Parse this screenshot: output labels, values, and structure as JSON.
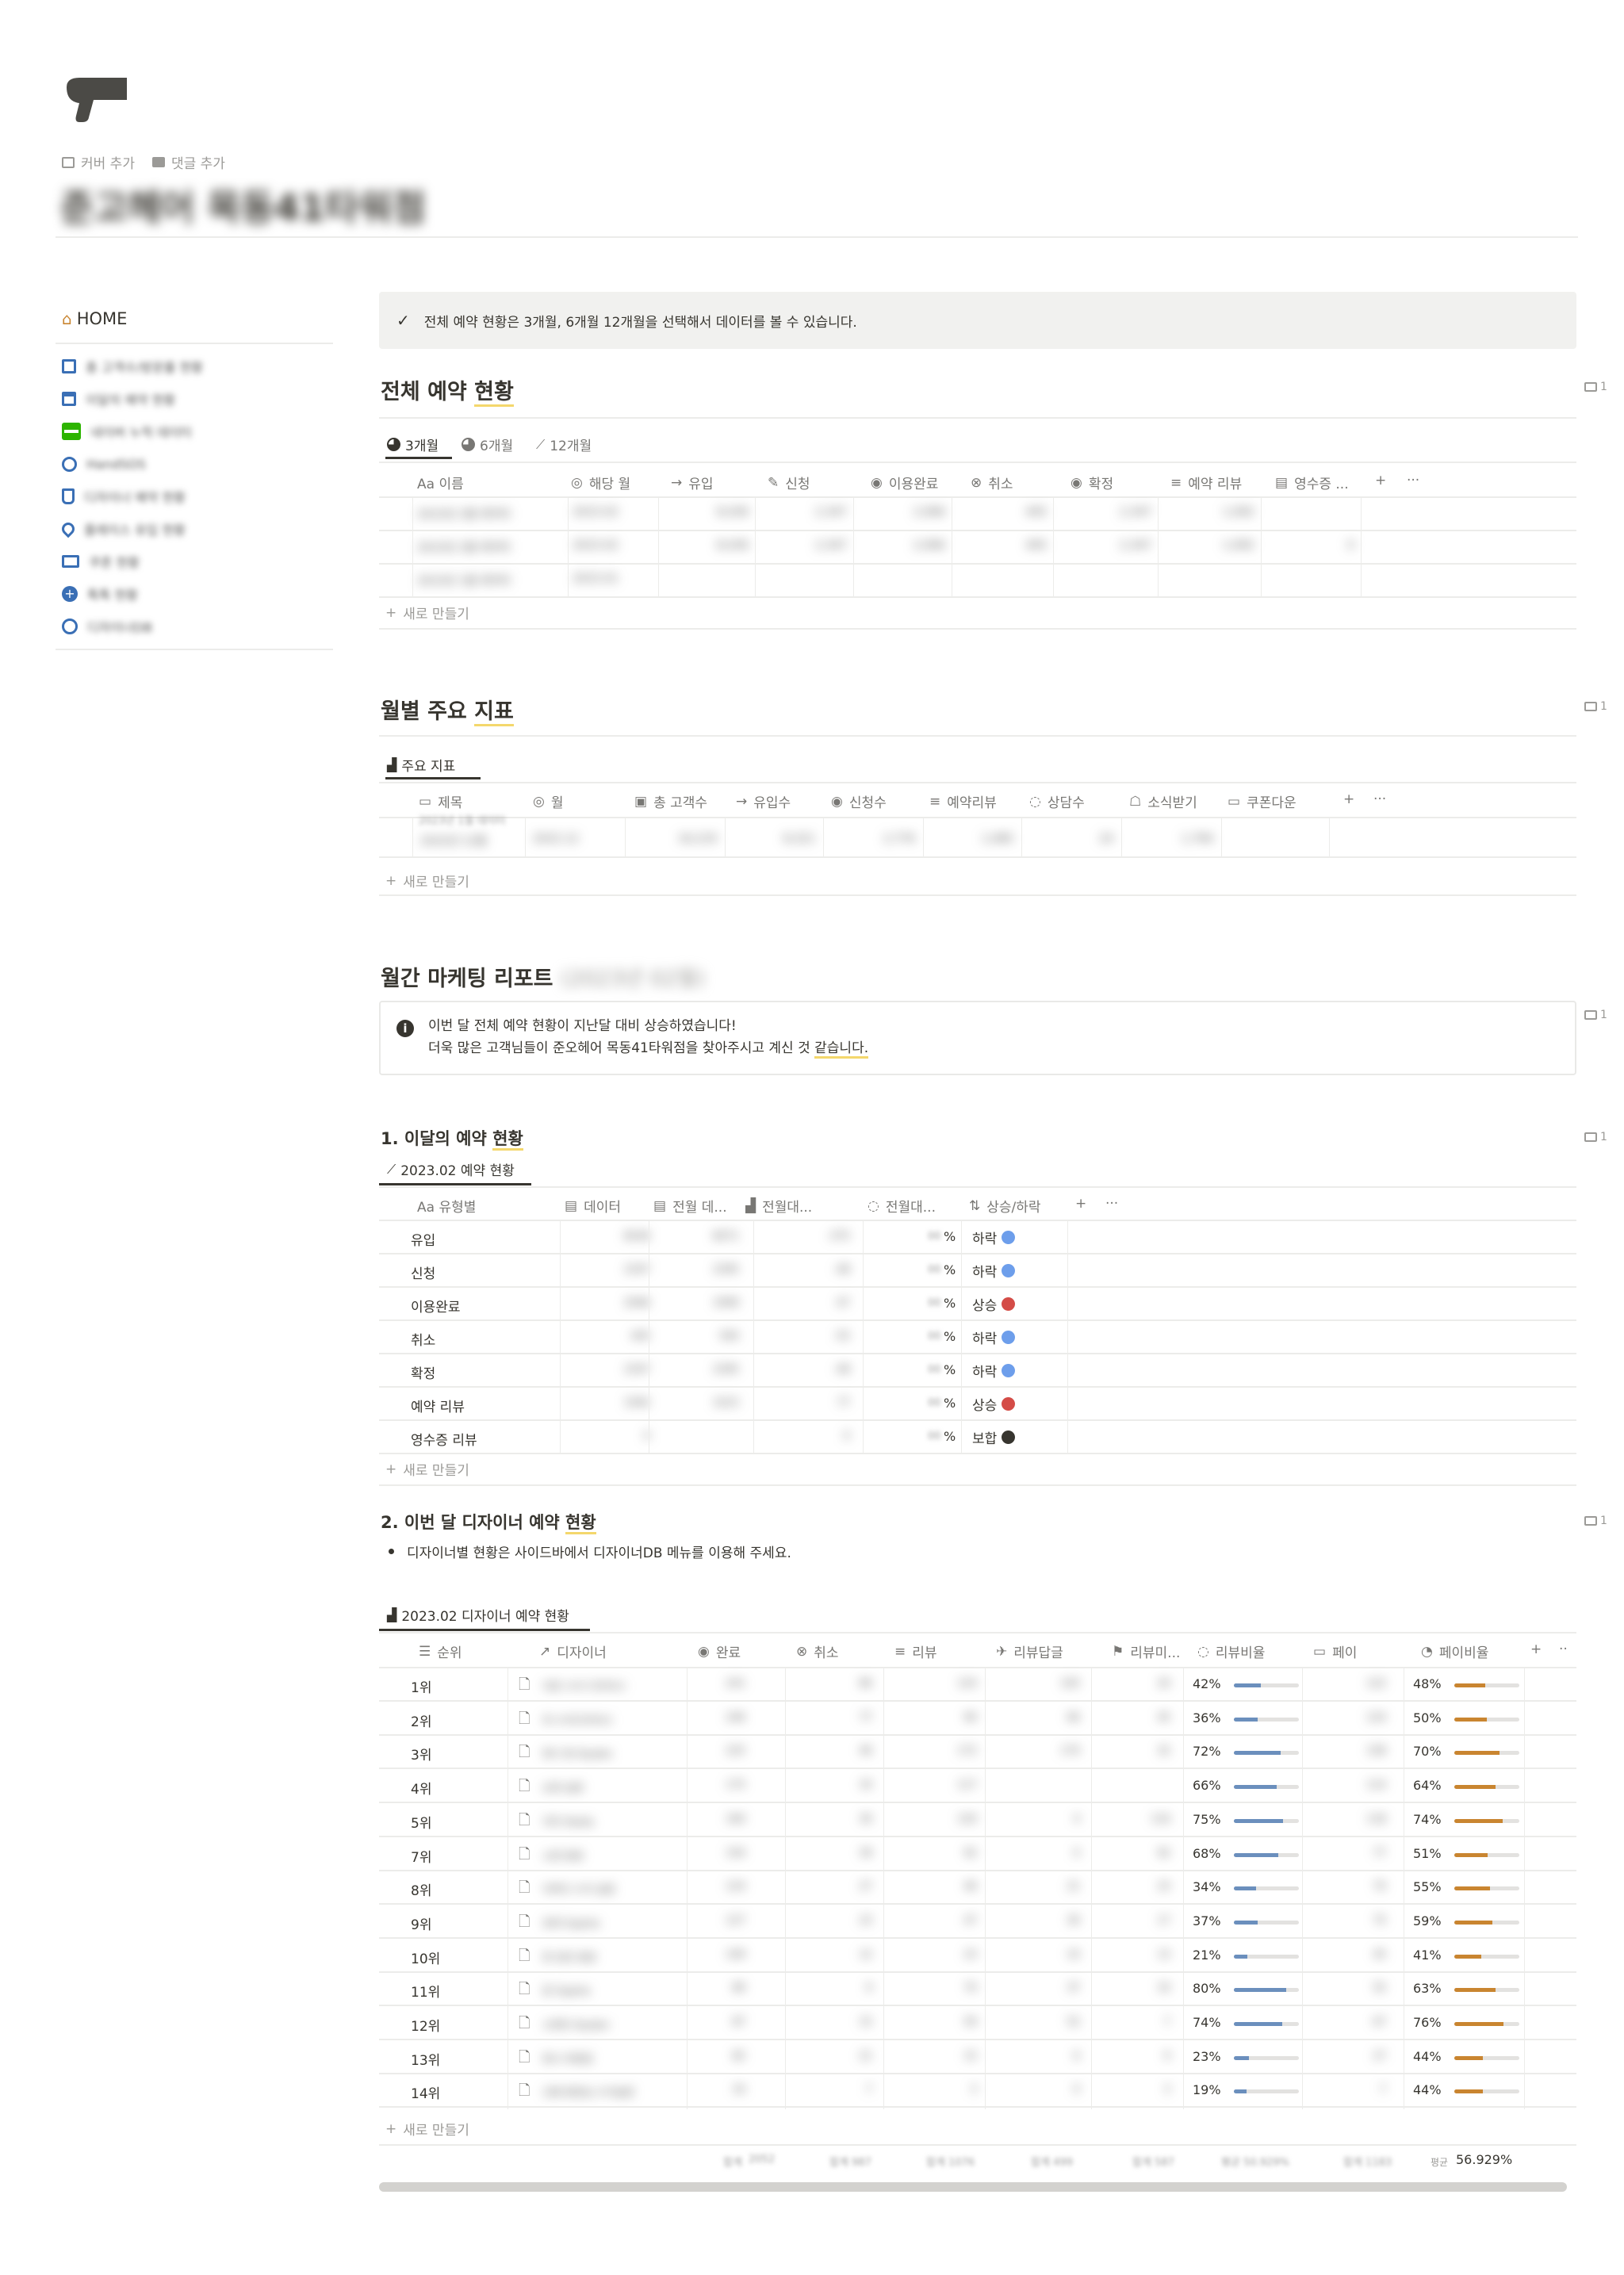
{
  "top": {
    "cover_label": "커버 추가",
    "comment_label": "댓글 추가",
    "page_title": "준고헤어 목동41타워점"
  },
  "sidebar": {
    "home": "HOME",
    "items": [
      {
        "label": "총 고객수/방문률 현황",
        "icon": "database-icon"
      },
      {
        "label": "이달의 예약 현황",
        "icon": "calendar-icon"
      },
      {
        "label": "네이버 누적 데이터",
        "icon": "naver-icon"
      },
      {
        "label": "HandSOS",
        "icon": "globe-icon"
      },
      {
        "label": "디자이너 예약 현황",
        "icon": "plug-icon"
      },
      {
        "label": "플레이스 유입 현황",
        "icon": "location-icon"
      },
      {
        "label": "쿠폰 현황",
        "icon": "ticket-icon"
      },
      {
        "label": "톡톡 현황",
        "icon": "chat-plus-icon"
      },
      {
        "label": "디자이너DB",
        "icon": "person-icon"
      }
    ]
  },
  "callout1": "전체 예약 현황은 3개월, 6개월 12개월을 선택해서 데이터를 볼 수 있습니다.",
  "section1": {
    "title_a": "전체 예약 ",
    "title_b": "현황",
    "comment_count": "1",
    "tabs": [
      "3개월",
      "6개월",
      "12개월"
    ],
    "headers": [
      "Aa 이름",
      "해당 월",
      "유입",
      "신청",
      "이용완료",
      "취소",
      "확정",
      "예약 리뷰",
      "영수증 ..."
    ],
    "rows": [
      [
        "2023년 2월 데이터",
        "2023.02",
        "8,436",
        "2,347",
        "2,066",
        "445",
        "2,347",
        "1,092",
        ""
      ],
      [
        "2023년 2월 데이터",
        "2023.02",
        "8,436",
        "2,347",
        "2,066",
        "445",
        "2,347",
        "1,092",
        "0"
      ],
      [
        "2023년 1월 데이터",
        "2023.01",
        "",
        "",
        "",
        "",
        "",
        "",
        ""
      ]
    ],
    "new_row": "새로 만들기"
  },
  "section2": {
    "title_a": "월별 주요 ",
    "title_b": "지표",
    "comment_count": "1",
    "tab": "주요 지표",
    "headers": [
      "제목",
      "월",
      "총 고객수",
      "유입수",
      "신청수",
      "예약리뷰",
      "상담수",
      "소식받기",
      "쿠폰다운"
    ],
    "rows": [
      [
        "2022년 12월",
        "2022.12",
        "16,219",
        "8,321",
        "2,776",
        "1,085",
        "24",
        "1,794",
        ""
      ]
    ],
    "new_row": "새로 만들기"
  },
  "section3": {
    "title": "월간 마케팅 리포트",
    "title_blur": "(2023년 02월)",
    "comment_count": "1",
    "info_line1": "이번 달 전체 예약 현황이 지난달 대비 상승하였습니다!",
    "info_line2_a": "더욱 많은 고객님들이 준오헤어 목동41타워점을 찾아주시고 계신 것 ",
    "info_line2_b": "같습니다."
  },
  "section4": {
    "title_a": "1. 이달의 예약 ",
    "title_b": "현황",
    "comment_count": "1",
    "tab": "2023.02 예약 현황",
    "headers": [
      "Aa 유형별",
      "데이터",
      "전월 데...",
      "전월대...",
      "전월대...",
      "상승/하락"
    ],
    "rows": [
      {
        "type": "유입",
        "data": "8436",
        "prev": "8471",
        "diff": "-375",
        "pct": "%",
        "trend": "하락",
        "color": "#6d9eeb"
      },
      {
        "type": "신청",
        "data": "2347",
        "prev": "2395",
        "diff": "-48",
        "pct": "%",
        "trend": "하락",
        "color": "#6d9eeb"
      },
      {
        "type": "이용완료",
        "data": "2066",
        "prev": "1999",
        "diff": "67",
        "pct": "%",
        "trend": "상승",
        "color": "#d44c47"
      },
      {
        "type": "취소",
        "data": "445",
        "prev": "500",
        "diff": "-55",
        "pct": "%",
        "trend": "하락",
        "color": "#6d9eeb"
      },
      {
        "type": "확정",
        "data": "2347",
        "prev": "2395",
        "diff": "-48",
        "pct": "%",
        "trend": "하락",
        "color": "#6d9eeb"
      },
      {
        "type": "예약 리뷰",
        "data": "1092",
        "prev": "1015",
        "diff": "77",
        "pct": "%",
        "trend": "상승",
        "color": "#d44c47"
      },
      {
        "type": "영수증 리뷰",
        "data": "0",
        "prev": "",
        "diff": "0",
        "pct": "%",
        "trend": "보합",
        "color": "#37352f"
      }
    ],
    "new_row": "새로 만들기"
  },
  "section5": {
    "title_a": "2. 이번 달 디자이너 예약 ",
    "title_b": "현황",
    "comment_count": "1",
    "bullet": "디자이너별 현황은 사이드바에서 디자이너DB 메뉴를 이용해 주세요.",
    "tab": "2023.02 디자이너 예약 현황",
    "headers": [
      "순위",
      "디자이너",
      "완료",
      "취소",
      "리뷰",
      "리뷰답글",
      "리뷰미...",
      "리뷰비율",
      "페이",
      "페이비율"
    ],
    "rows": [
      {
        "rank": "1위",
        "name": "이준 수석 디자이너",
        "done": "241",
        "cancel": "86",
        "review": "124",
        "reply": "105",
        "unr": "20",
        "rr": "42%",
        "rrv": 0.42,
        "pay": "122",
        "pr": "48%",
        "prv": 0.48
      },
      {
        "rank": "2위",
        "name": "최 수석디자이너",
        "done": "246",
        "cancel": "77",
        "review": "90",
        "reply": "66",
        "unr": "45",
        "rr": "36%",
        "rrv": 0.36,
        "pay": "124",
        "pr": "50%",
        "prv": 0.5
      },
      {
        "rank": "3위",
        "name": "현시 원 Aiyden",
        "done": "225",
        "cancel": "46",
        "review": "172",
        "reply": "170",
        "unr": "32",
        "rr": "72%",
        "rrv": 0.72,
        "pay": "158",
        "pr": "70%",
        "prv": 0.7
      },
      {
        "rank": "4위",
        "name": "손정 실장",
        "done": "175",
        "cancel": "33",
        "review": "117",
        "reply": "",
        "unr": "",
        "rr": "66%",
        "rrv": 0.66,
        "pay": "114",
        "pr": "64%",
        "prv": 0.64
      },
      {
        "rank": "5위",
        "name": "지아 Stella",
        "done": "160",
        "cancel": "30",
        "review": "120",
        "reply": "4",
        "unr": "116",
        "rr": "75%",
        "rrv": 0.75,
        "pay": "118",
        "pr": "74%",
        "prv": 0.74
      },
      {
        "rank": "7위",
        "name": "소현 원장",
        "done": "150",
        "cancel": "39",
        "review": "92",
        "reply": "0",
        "unr": "92",
        "rr": "68%",
        "rrv": 0.68,
        "pay": "77",
        "pr": "51%",
        "prv": 0.51
      },
      {
        "rank": "8위",
        "name": "이하다 수석 실장",
        "done": "124",
        "cancel": "27",
        "review": "46",
        "reply": "21",
        "unr": "23",
        "rr": "34%",
        "rrv": 0.34,
        "pay": "70",
        "pr": "55%",
        "prv": 0.55
      },
      {
        "rank": "9위",
        "name": "유희 Sophie",
        "done": "127",
        "cancel": "23",
        "review": "47",
        "reply": "30",
        "unr": "17",
        "rr": "37%",
        "rrv": 0.37,
        "pay": "75",
        "pr": "59%",
        "prv": 0.59
      },
      {
        "rank": "10위",
        "name": "한 반콘 원장",
        "done": "109",
        "cancel": "12",
        "review": "23",
        "reply": "10",
        "unr": "13",
        "rr": "21%",
        "rrv": 0.21,
        "pay": "45",
        "pr": "41%",
        "prv": 0.41
      },
      {
        "rank": "11위",
        "name": "윤 Sophie",
        "done": "89",
        "cancel": "9",
        "review": "70",
        "reply": "37",
        "unr": "33",
        "rr": "80%",
        "rrv": 0.8,
        "pay": "55",
        "pr": "63%",
        "prv": 0.63
      },
      {
        "rank": "12위",
        "name": "소현진 Aiyden",
        "done": "87",
        "cancel": "15",
        "review": "59",
        "reply": "52",
        "unr": "7",
        "rr": "74%",
        "rrv": 0.74,
        "pay": "67",
        "pr": "76%",
        "prv": 0.76
      },
      {
        "rank": "13위",
        "name": "현시 부원장",
        "done": "82",
        "cancel": "21",
        "review": "15",
        "reply": "6",
        "unr": "9",
        "rr": "23%",
        "rrv": 0.23,
        "pay": "27",
        "pr": "44%",
        "prv": 0.44
      },
      {
        "rank": "14위",
        "name": "신형 원장님 수석실장",
        "done": "16",
        "cancel": "7",
        "review": "3",
        "reply": "0",
        "unr": "3",
        "rr": "19%",
        "rrv": 0.19,
        "pay": "7",
        "pr": "44%",
        "prv": 0.44
      }
    ],
    "new_row": "새로 만들기",
    "footer": {
      "sum_label": "합계",
      "sum_vals": [
        "2052",
        "합계 987",
        "합계 1076",
        "합계 499",
        "합계 587",
        "평균 50.929%",
        "합계 1183"
      ],
      "avg_label": "평균",
      "avg_value": "56.929%"
    }
  },
  "colors": {
    "accent_underline": "#f4d76c",
    "bar_blue": "#6b8fbd",
    "bar_orange": "#c98530",
    "naver_green": "#2db400"
  }
}
